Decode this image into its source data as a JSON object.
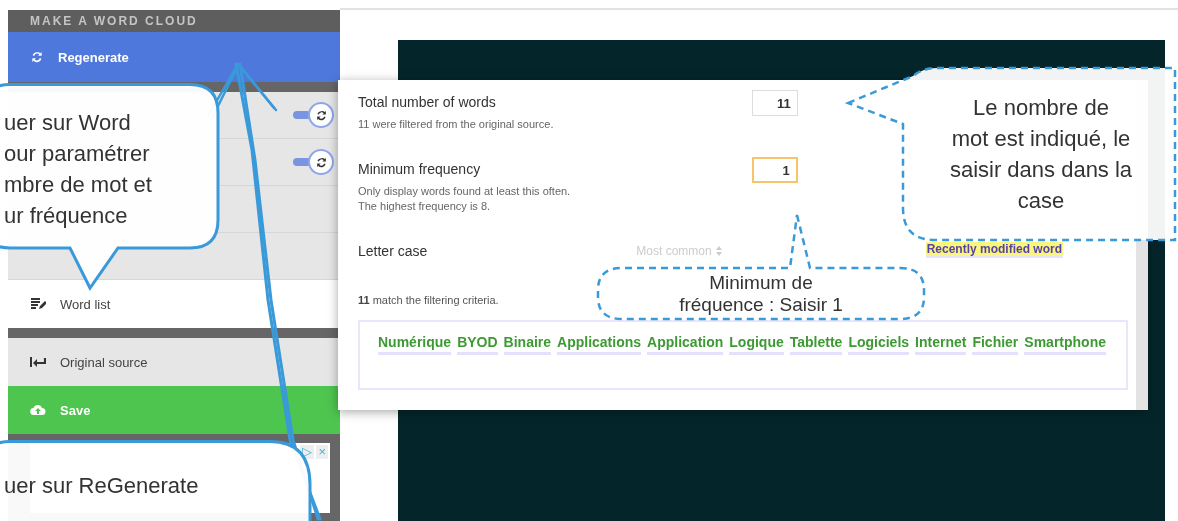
{
  "sidebar": {
    "title": "MAKE A WORD CLOUD",
    "regenerate": "Regenerate",
    "settings_rows": [
      {
        "kind": "toggle"
      },
      {
        "kind": "toggle"
      },
      {
        "kind": "plain"
      },
      {
        "kind": "plain"
      }
    ],
    "word_list": {
      "label": "Word list",
      "selected": true
    },
    "original_source": {
      "label": "Original source",
      "selected": false
    },
    "save": "Save",
    "ad": {
      "choices": "▷",
      "close": "×"
    }
  },
  "dialog": {
    "fields": [
      {
        "label": "Total number of words",
        "notes": [
          "11 were filtered from the original source."
        ],
        "value": "11",
        "focused": false
      },
      {
        "label": "Minimum frequency",
        "notes": [
          "Only display words found at least this often.",
          "The highest frequency is 8."
        ],
        "value": "1",
        "focused": true
      }
    ],
    "letter_case": {
      "label": "Letter case",
      "value": "Most common"
    },
    "match_text": "**11** match the filtering criteria.",
    "words": [
      "Numérique",
      "BYOD",
      "Binaire",
      "Applications",
      "Application",
      "Logique",
      "Tablette",
      "Logiciels",
      "Internet",
      "Fichier",
      "Smartphone"
    ],
    "legend": [
      {
        "label": "Recently modified word",
        "kind": "recent"
      }
    ]
  },
  "callouts": [
    {
      "kind": "solid",
      "text": "uer sur Word\nour paramétrer\nmbre de mot et\nur fréquence"
    },
    {
      "kind": "dashed",
      "text": "Le nombre de\nmot est indiqué, le\nsaisir dans dans la\ncase"
    },
    {
      "kind": "dashed",
      "text": "Minimum de\nfréquence : Saisir 1"
    },
    {
      "kind": "solid",
      "text": "uer sur ReGenerate"
    }
  ]
}
